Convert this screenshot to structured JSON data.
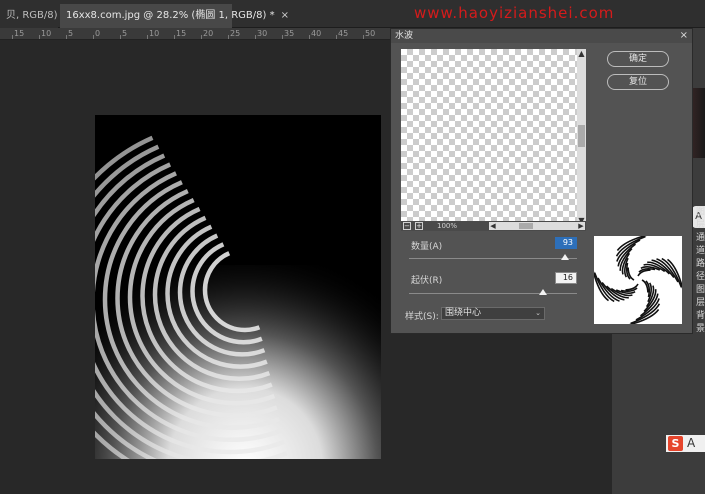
{
  "tabs": [
    {
      "label": "贝, RGB/8) *",
      "close": "×"
    },
    {
      "label": "16xx8.com.jpg @ 28.2% (椭圆 1, RGB/8) *",
      "close": "×"
    }
  ],
  "ruler": {
    "labels": [
      "15",
      "10",
      "5",
      "0",
      "5",
      "10",
      "15",
      "20",
      "25",
      "30",
      "35",
      "40",
      "45",
      "50",
      "55"
    ]
  },
  "watermark": "www.haoyizianshei.com",
  "dialog": {
    "title": "水波",
    "close": "×",
    "ok_label": "确定",
    "reset_label": "复位",
    "zoom_out": "−",
    "zoom_in": "+",
    "zoom_value": "100%",
    "amount_label": "数量(A)",
    "amount_value": "93",
    "amount": 93,
    "amount_max": 100,
    "ridges_label": "起伏(R)",
    "ridges_value": "16",
    "ridges": 16,
    "ridges_max": 20,
    "style_label": "样式(S):",
    "style_value": "围绕中心",
    "scroll_up": "▲",
    "scroll_down": "▼",
    "scroll_left": "◀",
    "scroll_right": "▶"
  },
  "right_panel": {
    "badge": "A",
    "labels": [
      "图层",
      "通道",
      "路径",
      "图层",
      "背景"
    ]
  },
  "brand_badge": {
    "s": "S",
    "a": "A"
  },
  "colors": {
    "accent": "#2d6fb9",
    "watermark": "#d51b1b"
  }
}
